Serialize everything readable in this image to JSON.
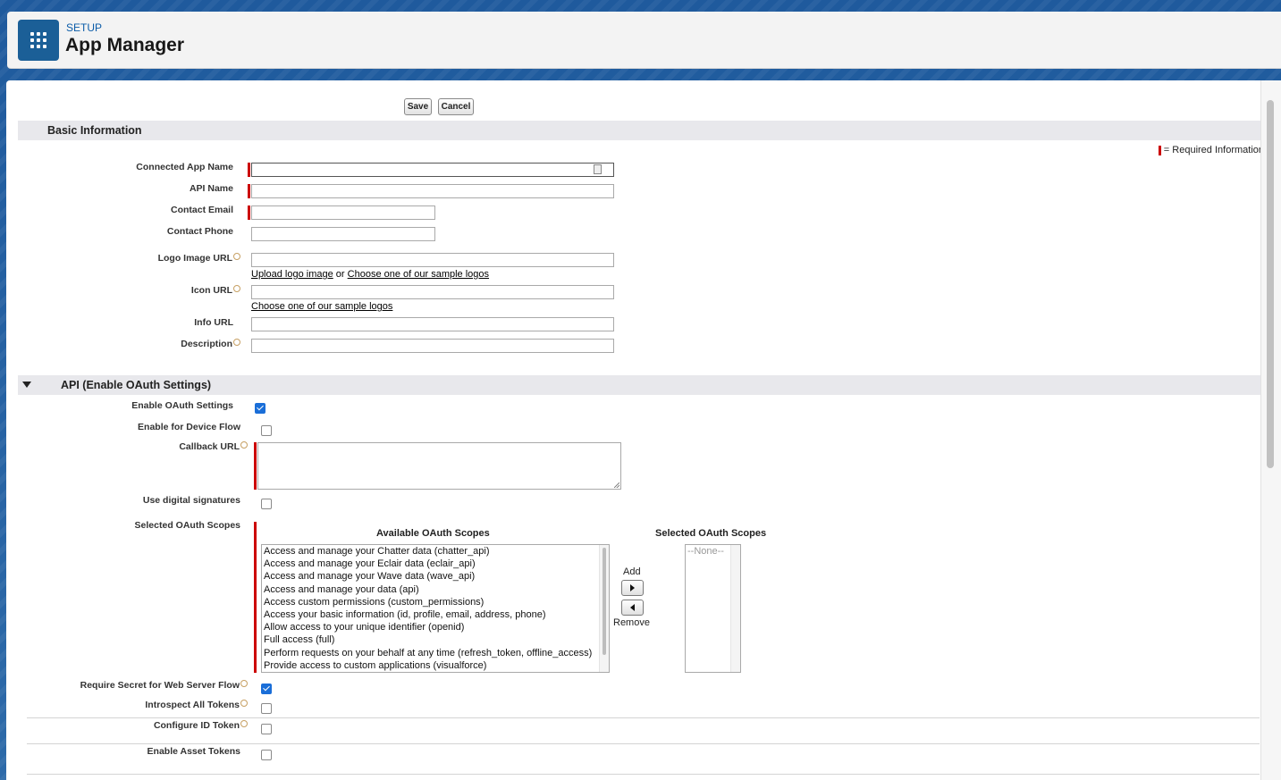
{
  "header": {
    "setup_label": "SETUP",
    "title": "App Manager",
    "app_icon": "app-launcher-grid-icon"
  },
  "toolbar": {
    "save_label": "Save",
    "cancel_label": "Cancel"
  },
  "basic_info": {
    "section_title": "Basic Information",
    "required_legend": "= Required Information",
    "connected_app_name_label": "Connected App Name",
    "api_name_label": "API Name",
    "contact_email_label": "Contact Email",
    "contact_phone_label": "Contact Phone",
    "logo_image_url_label": "Logo Image URL",
    "upload_logo_link": "Upload logo image",
    "or_text": " or ",
    "choose_logo_link": "Choose one of our sample logos",
    "icon_url_label": "Icon URL",
    "choose_icon_link": "Choose one of our sample logos",
    "info_url_label": "Info URL",
    "description_label": "Description"
  },
  "api_section": {
    "section_title": "API (Enable OAuth Settings)",
    "enable_oauth_label": "Enable OAuth Settings",
    "enable_oauth_checked": true,
    "device_flow_label": "Enable for Device Flow",
    "device_flow_checked": false,
    "callback_url_label": "Callback URL",
    "digital_signatures_label": "Use digital signatures",
    "digital_signatures_checked": false,
    "selected_scopes_label": "Selected OAuth Scopes",
    "available_scopes_header": "Available OAuth Scopes",
    "selected_scopes_header": "Selected OAuth Scopes",
    "available_scopes": [
      "Access and manage your Chatter data (chatter_api)",
      "Access and manage your Eclair data (eclair_api)",
      "Access and manage your Wave data (wave_api)",
      "Access and manage your data (api)",
      "Access custom permissions (custom_permissions)",
      "Access your basic information (id, profile, email, address, phone)",
      "Allow access to your unique identifier (openid)",
      "Full access (full)",
      "Perform requests on your behalf at any time (refresh_token, offline_access)",
      "Provide access to custom applications (visualforce)"
    ],
    "selected_scopes_placeholder": "--None--",
    "add_label": "Add",
    "remove_label": "Remove",
    "require_secret_label": "Require Secret for Web Server Flow",
    "require_secret_checked": true,
    "introspect_label": "Introspect All Tokens",
    "introspect_checked": false,
    "configure_id_token_label": "Configure ID Token",
    "configure_id_token_checked": false,
    "asset_tokens_label": "Enable Asset Tokens",
    "asset_tokens_checked": false
  }
}
